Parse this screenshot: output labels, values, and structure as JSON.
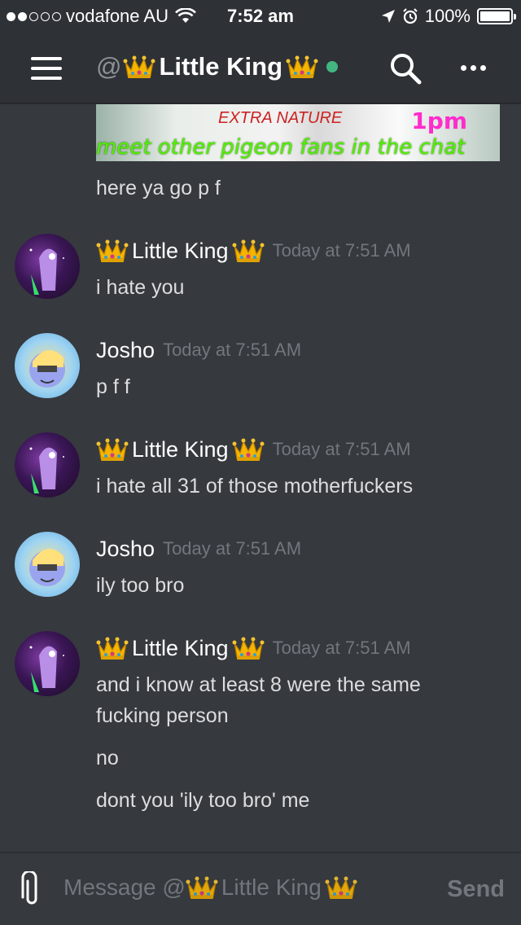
{
  "status_bar": {
    "carrier": "vodafone AU",
    "time": "7:52 am",
    "battery": "100%"
  },
  "header": {
    "at": "@",
    "title": "Little King"
  },
  "meme": {
    "top_text": "EXTRA NATURE",
    "time_text": "1pm",
    "caption": "meet other pigeon fans in the chat"
  },
  "chat": {
    "first_line": "here ya go p f",
    "messages": [
      {
        "author": "Little King",
        "crowned": true,
        "timestamp": "Today at 7:51 AM",
        "lines": [
          "i hate you"
        ]
      },
      {
        "author": "Josho",
        "crowned": false,
        "timestamp": "Today at 7:51 AM",
        "lines": [
          "p f f"
        ]
      },
      {
        "author": "Little King",
        "crowned": true,
        "timestamp": "Today at 7:51 AM",
        "lines": [
          "i hate all 31 of those motherfuckers"
        ]
      },
      {
        "author": "Josho",
        "crowned": false,
        "timestamp": "Today at 7:51 AM",
        "lines": [
          "ily too bro"
        ]
      },
      {
        "author": "Little King",
        "crowned": true,
        "timestamp": "Today at 7:51 AM",
        "lines": [
          "and i know at least 8 were the same fucking person",
          "no",
          "dont you 'ily too bro' me"
        ]
      }
    ]
  },
  "input": {
    "placeholder_prefix": "Message @",
    "placeholder_name": "Little King",
    "send_label": "Send"
  },
  "colors": {
    "background": "#36393e",
    "header": "#2e3136",
    "online": "#43b581",
    "timestamp": "#72767d",
    "text": "#dcddde"
  },
  "icons": [
    "menu-icon",
    "crown-icon",
    "search-icon",
    "more-icon",
    "paperclip-icon",
    "wifi-icon",
    "location-icon",
    "alarm-icon"
  ]
}
